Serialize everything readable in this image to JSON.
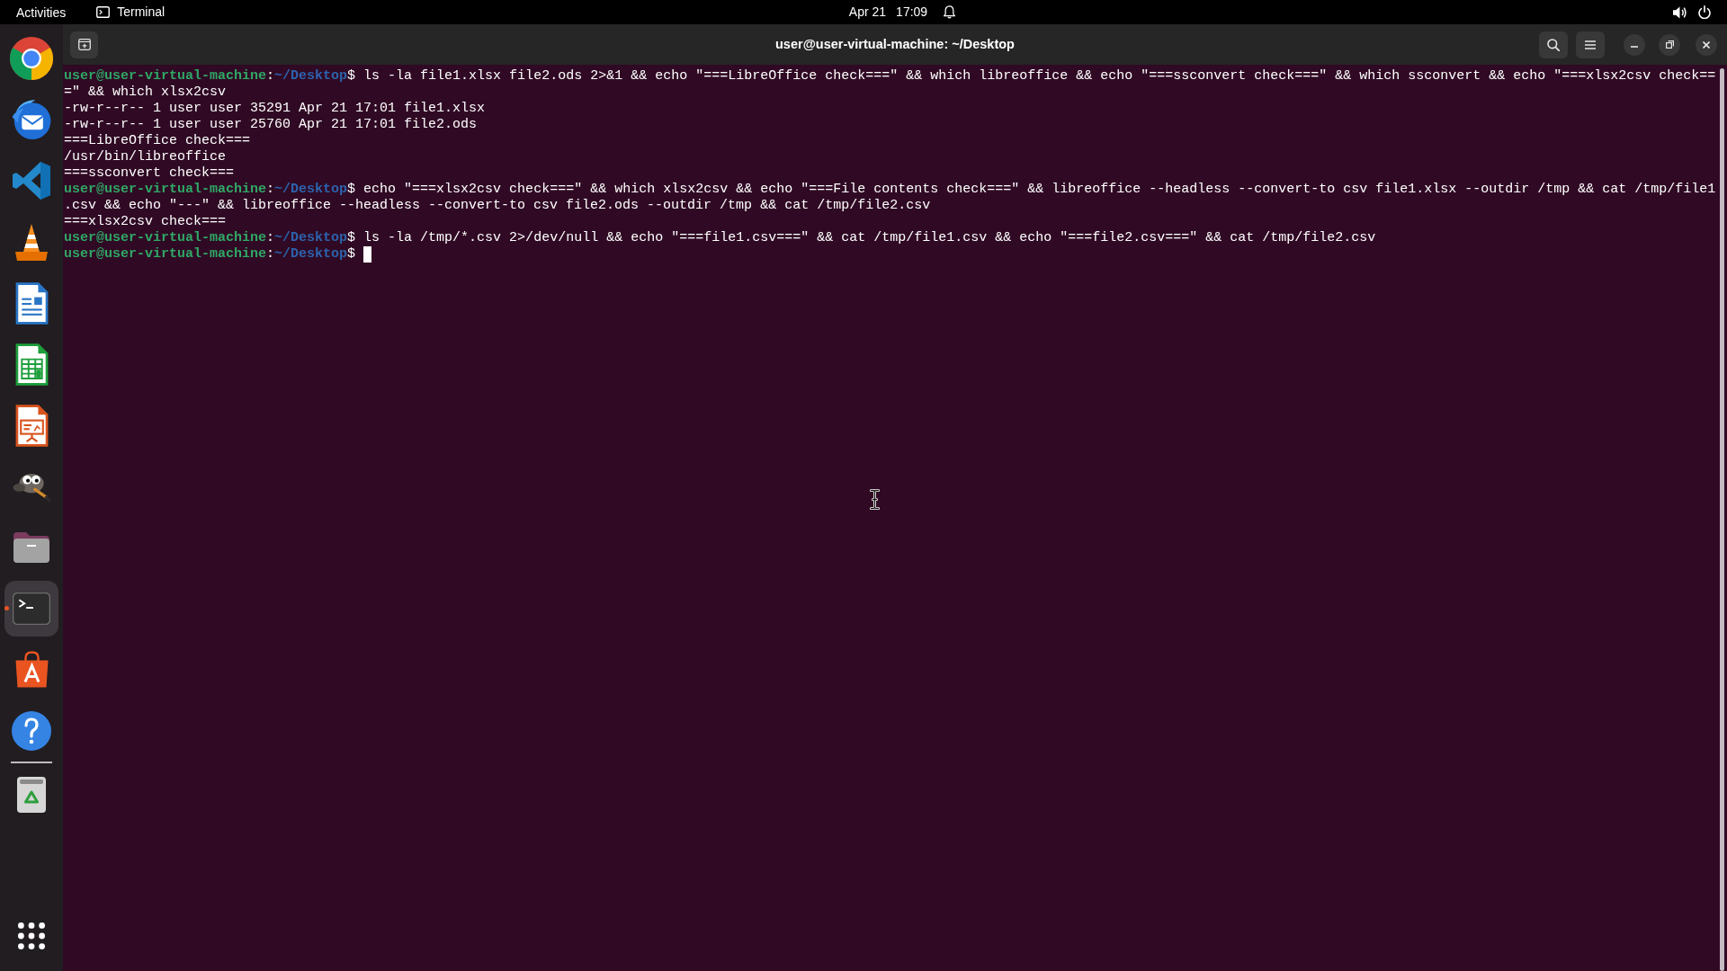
{
  "top_bar": {
    "activities": "Activities",
    "app_menu": "Terminal",
    "date": "Apr 21",
    "time": "17:09"
  },
  "dock": {
    "items": [
      {
        "running": false,
        "focused": false
      },
      {
        "running": false,
        "focused": false
      },
      {
        "running": false,
        "focused": false
      },
      {
        "running": false,
        "focused": false
      },
      {
        "running": false,
        "focused": false
      },
      {
        "running": false,
        "focused": false
      },
      {
        "running": false,
        "focused": false
      },
      {
        "running": false,
        "focused": false
      },
      {
        "running": false,
        "focused": false
      },
      {
        "running": true,
        "focused": true
      },
      {
        "running": false,
        "focused": false
      },
      {
        "running": false,
        "focused": false
      }
    ]
  },
  "terminal": {
    "title": "user@user-virtual-machine: ~/Desktop",
    "lines": [
      {
        "kind": "prompt",
        "user_host": "user@user-virtual-machine",
        "separator": ":",
        "path": "~/Desktop",
        "sigil": "$",
        "command": "ls -la file1.xlsx file2.ods 2>&1 && echo \"===LibreOffice check===\" && which libreoffice && echo \"===ssconvert check===\" && which ssconvert && echo \"===xlsx2csv check==",
        "cursor": false
      },
      {
        "kind": "continuation",
        "text": "=\" && which xlsx2csv"
      },
      {
        "kind": "output",
        "text": "-rw-r--r-- 1 user user 35291 Apr 21 17:01 file1.xlsx"
      },
      {
        "kind": "output",
        "text": "-rw-r--r-- 1 user user 25760 Apr 21 17:01 file2.ods"
      },
      {
        "kind": "output",
        "text": "===LibreOffice check==="
      },
      {
        "kind": "output",
        "text": "/usr/bin/libreoffice"
      },
      {
        "kind": "output",
        "text": "===ssconvert check==="
      },
      {
        "kind": "prompt",
        "user_host": "user@user-virtual-machine",
        "separator": ":",
        "path": "~/Desktop",
        "sigil": "$",
        "command": "echo \"===xlsx2csv check===\" && which xlsx2csv && echo \"===File contents check===\" && libreoffice --headless --convert-to csv file1.xlsx --outdir /tmp && cat /tmp/file1",
        "cursor": false
      },
      {
        "kind": "continuation",
        "text": ".csv && echo \"---\" && libreoffice --headless --convert-to csv file2.ods --outdir /tmp && cat /tmp/file2.csv"
      },
      {
        "kind": "output",
        "text": "===xlsx2csv check==="
      },
      {
        "kind": "prompt",
        "user_host": "user@user-virtual-machine",
        "separator": ":",
        "path": "~/Desktop",
        "sigil": "$",
        "command": "ls -la /tmp/*.csv 2>/dev/null && echo \"===file1.csv===\" && cat /tmp/file1.csv && echo \"===file2.csv===\" && cat /tmp/file2.csv",
        "cursor": false
      },
      {
        "kind": "prompt",
        "user_host": "user@user-virtual-machine",
        "separator": ":",
        "path": "~/Desktop",
        "sigil": "$",
        "cursor": true
      }
    ]
  }
}
